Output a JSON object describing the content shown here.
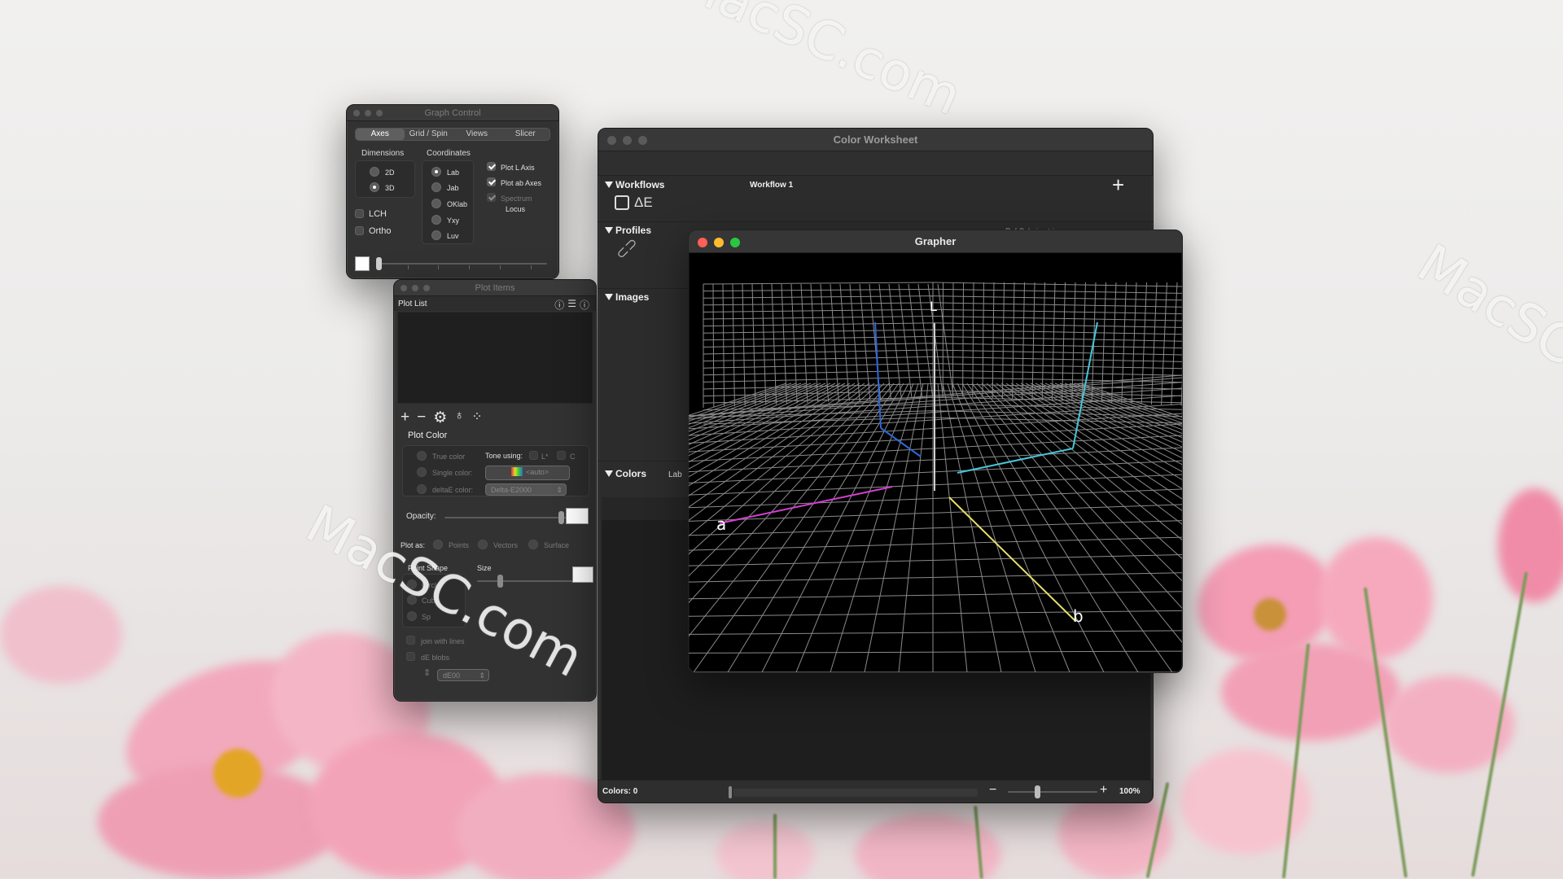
{
  "graph_control": {
    "title": "Graph Control",
    "tabs": [
      "Axes",
      "Grid / Spin",
      "Views",
      "Slicer"
    ],
    "active_tab": "Axes",
    "dimensions_label": "Dimensions",
    "dimensions": [
      "2D",
      "3D"
    ],
    "selected_dimension": "3D",
    "coordinates_label": "Coordinates",
    "coordinates": [
      "Lab",
      "Jab",
      "OKlab",
      "Yxy",
      "Luv"
    ],
    "selected_coordinate": "Lab",
    "plot_l_axis": "Plot L Axis",
    "plot_ab_axes": "Plot ab Axes",
    "spectrum": "Spectrum",
    "locus": "Locus",
    "lch": "LCH",
    "ortho": "Ortho"
  },
  "plot_items": {
    "title": "Plot Items",
    "plot_list": "Plot List",
    "plot_color": "Plot Color",
    "true_color": "True color",
    "tone_using": "Tone using:",
    "l_star": "L*",
    "c": "C",
    "single_color": "Single color:",
    "single_color_value": "<auto>",
    "delta_e_color": "deltaE color:",
    "delta_e_value": "Delta-E2000",
    "opacity": "Opacity:",
    "plot_as": "Plot as:",
    "points": "Points",
    "vectors": "Vectors",
    "surface": "Surface",
    "point_shape": "Point Shape",
    "size": "Size",
    "circle": "Circle",
    "cube": "Cube",
    "sphere": "Sp",
    "join_lines": "join with lines",
    "de_blobs": "dE blobs",
    "de_value": "dE00"
  },
  "worksheet": {
    "title": "Color Worksheet",
    "workflows": "Workflows",
    "workflow_name": "Workflow 1",
    "delta_e_icon": "ΔE",
    "profiles": "Profiles",
    "profile_partial": "Ref Colorimetric",
    "images": "Images",
    "colors": "Colors",
    "colors_space": "Lab",
    "status_count": "Colors: 0",
    "zoom": "100%",
    "zoom_minus": "−",
    "zoom_plus": "+",
    "add": "+"
  },
  "grapher": {
    "title": "Grapher",
    "axis_l": "L",
    "axis_a": "a",
    "axis_b": "b"
  },
  "watermarks": [
    "MacSC.com",
    "MacSC.com",
    "MacSC.com"
  ],
  "colors": {
    "a_axis": "#d43fd0",
    "b_axis": "#e6e06a",
    "blue_axis": "#2e66d8",
    "cyan_axis": "#46c6d8"
  }
}
